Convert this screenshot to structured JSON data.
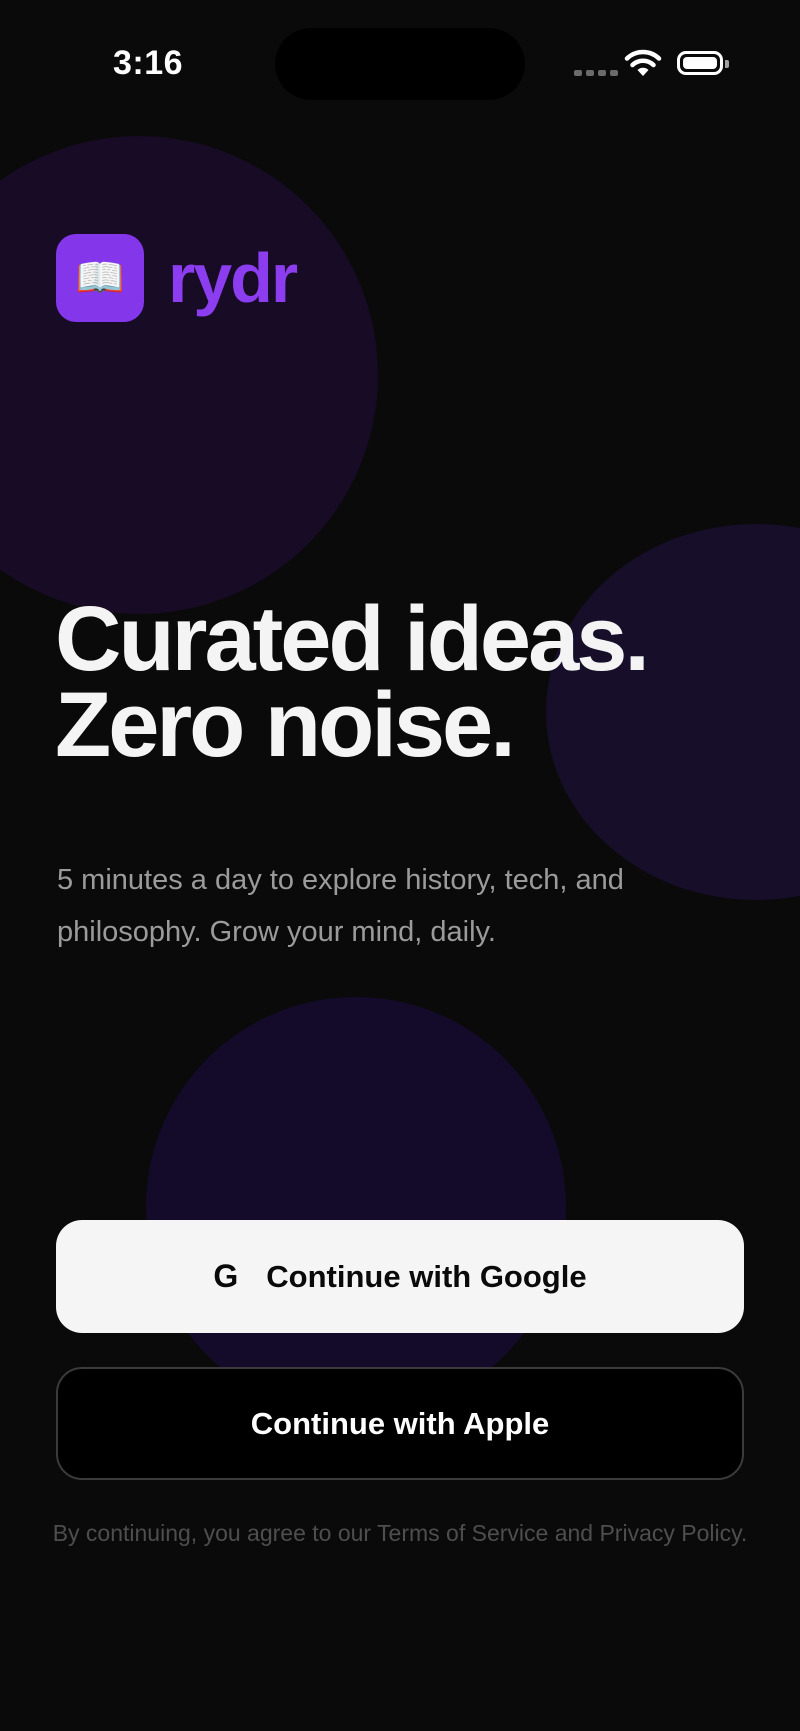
{
  "status_bar": {
    "time": "3:16",
    "wifi_icon": "wifi-icon",
    "battery_icon": "battery-icon"
  },
  "brand": {
    "logo_icon": "open-book-icon",
    "logo_glyph": "📖",
    "app_name": "rydr",
    "accent_color": "#8c3df0"
  },
  "hero": {
    "headline_line1": "Curated ideas.",
    "headline_line2": "Zero noise.",
    "subtitle": "5 minutes a day to explore history, tech, and philosophy. Grow your mind, daily."
  },
  "auth": {
    "google_icon_glyph": "G",
    "google_label": "Continue with Google",
    "apple_label": "Continue with Apple"
  },
  "legal": {
    "text": "By continuing, you agree to our Terms of Service and Privacy Policy."
  }
}
